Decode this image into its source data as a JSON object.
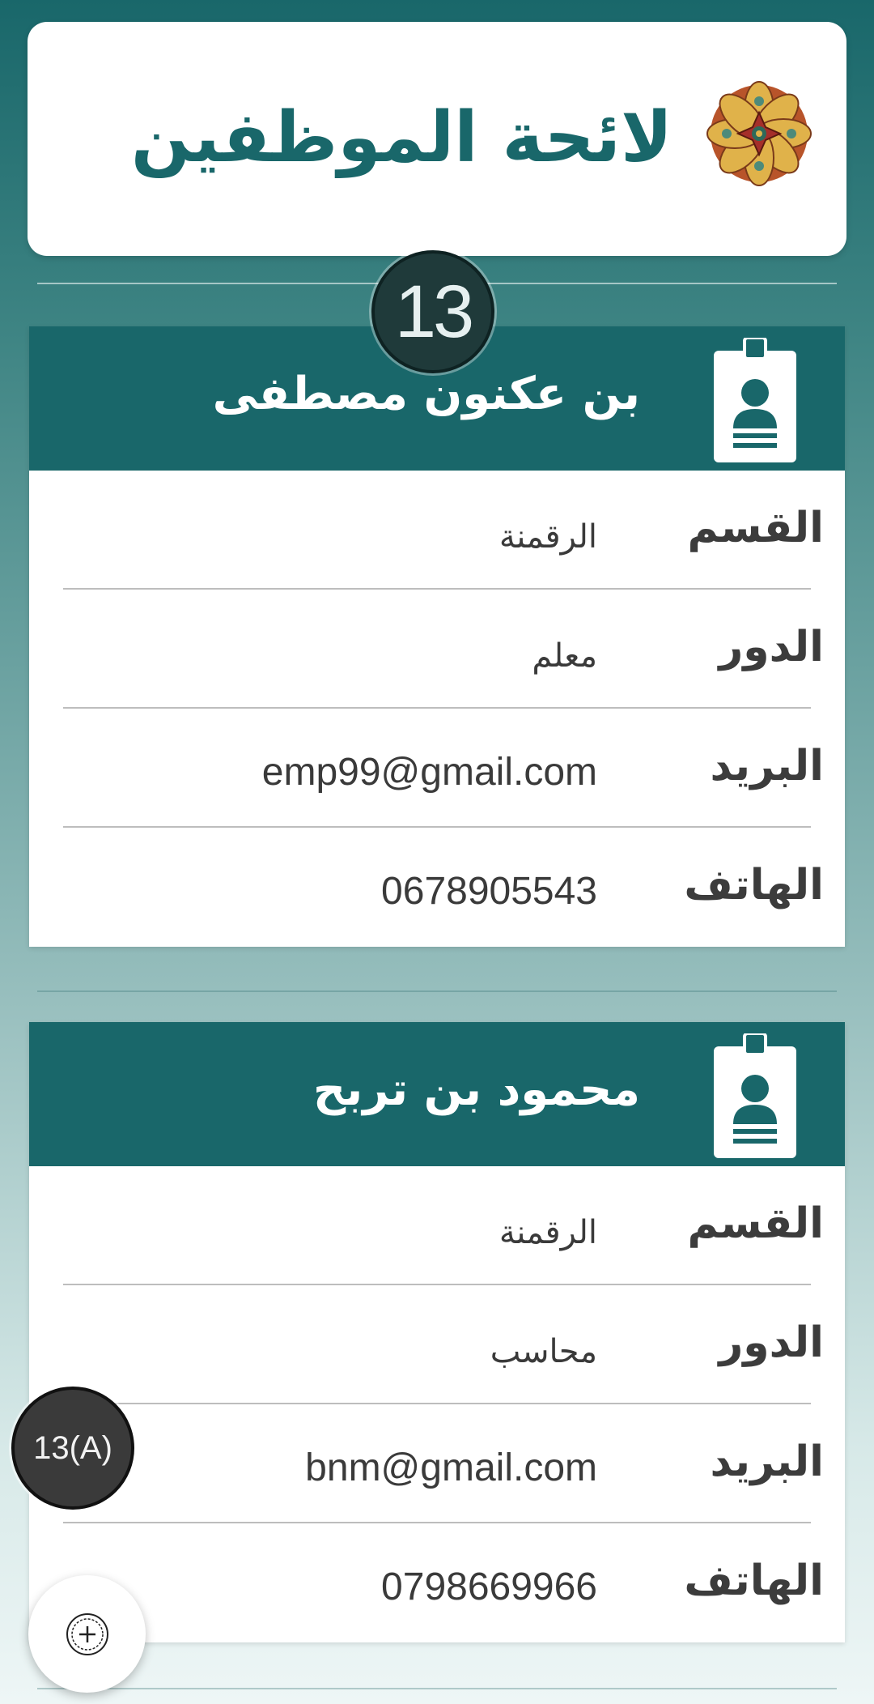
{
  "header": {
    "title": "لائحة الموظفين",
    "ornament_icon": "islamic-star-ornament-icon"
  },
  "badges": {
    "step": "13",
    "step_a": "13(A)"
  },
  "labels": {
    "department": "القسم",
    "role": "الدور",
    "email": "البريد",
    "phone": "الهاتف"
  },
  "employees": [
    {
      "name": "بن عكنون مصطفى",
      "department": "الرقمنة",
      "role": "معلم",
      "email": "emp99@gmail.com",
      "phone": "0678905543"
    },
    {
      "name": "محمود بن تربح",
      "department": "الرقمنة",
      "role": "محاسب",
      "email": "bnm@gmail.com",
      "phone": "0798669966"
    }
  ],
  "fab": {
    "icon": "add-circle-icon"
  },
  "colors": {
    "brand": "#19676a",
    "card": "#ffffff",
    "text": "#3c3c3c"
  }
}
